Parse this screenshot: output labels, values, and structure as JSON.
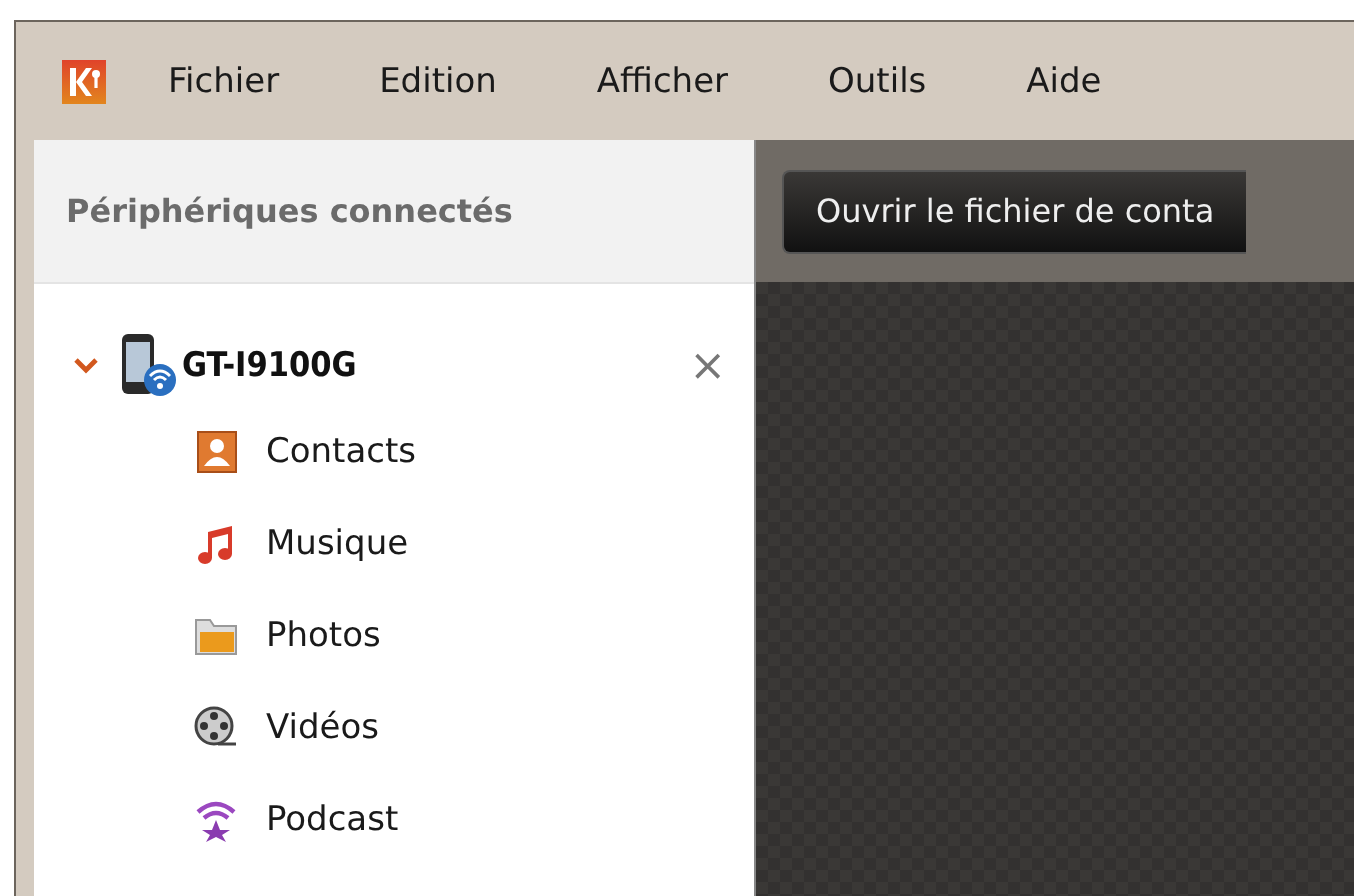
{
  "menu": [
    "Fichier",
    "Edition",
    "Afficher",
    "Outils",
    "Aide"
  ],
  "sidebar": {
    "title": "Périphériques connectés",
    "device": {
      "name": "GT-I9100G",
      "expanded": true,
      "close": "×",
      "children": [
        {
          "label": "Contacts",
          "kind": "contacts"
        },
        {
          "label": "Musique",
          "kind": "music"
        },
        {
          "label": "Photos",
          "kind": "photos"
        },
        {
          "label": "Vidéos",
          "kind": "videos"
        },
        {
          "label": "Podcast",
          "kind": "podcast"
        }
      ]
    }
  },
  "toolbar": {
    "button": "Ouvrir le fichier de conta"
  }
}
